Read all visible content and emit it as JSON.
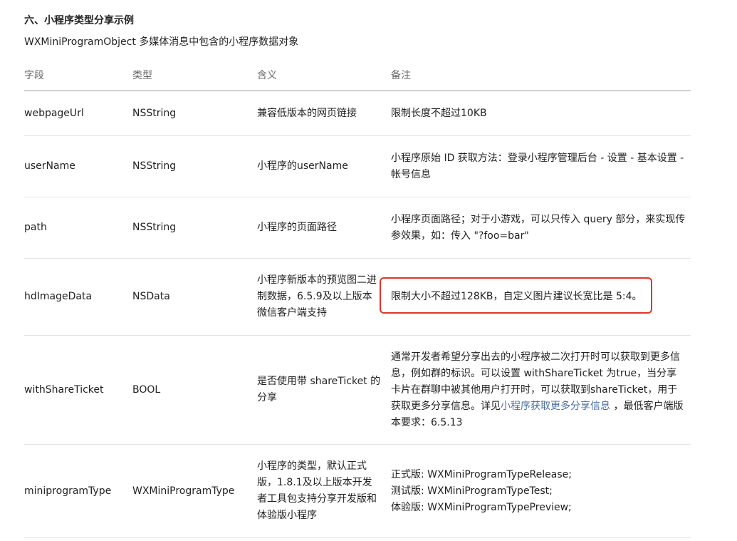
{
  "heading": {
    "title": "六、小程序类型分享示例",
    "description": "WXMiniProgramObject 多媒体消息中包含的小程序数据对象"
  },
  "table": {
    "headers": [
      "字段",
      "类型",
      "含义",
      "备注"
    ],
    "rows": [
      {
        "field": "webpageUrl",
        "type": "NSString",
        "meaning": "兼容低版本的网页链接",
        "note": "限制长度不超过10KB"
      },
      {
        "field": "userName",
        "type": "NSString",
        "meaning": "小程序的userName",
        "note": "小程序原始 ID 获取方法：登录小程序管理后台 - 设置 - 基本设置 - 帐号信息"
      },
      {
        "field": "path",
        "type": "NSString",
        "meaning": "小程序的页面路径",
        "note": "小程序页面路径；对于小游戏，可以只传入 query 部分，来实现传参效果，如：传入 \"?foo=bar\""
      },
      {
        "field": "hdImageData",
        "type": "NSData",
        "meaning": "小程序新版本的预览图二进制数据，6.5.9及以上版本微信客户端支持",
        "note": "限制大小不超过128KB，自定义图片建议长宽比是 5:4。"
      },
      {
        "field": "withShareTicket",
        "type": "BOOL",
        "meaning": "是否使用带 shareTicket 的分享",
        "note_before": "通常开发者希望分享出去的小程序被二次打开时可以获取到更多信息，例如群的标识。可以设置 withShareTicket 为true，当分享卡片在群聊中被其他用户打开时，可以获取到shareTicket，用于获取更多分享信息。详见",
        "note_link": "小程序获取更多分享信息",
        "note_after": " ，最低客户端版本要求：6.5.13"
      },
      {
        "field": "miniprogramType",
        "type": "WXMiniProgramType",
        "meaning": "小程序的类型，默认正式版，1.8.1及以上版本开发者工具包支持分享开发版和体验版小程序",
        "note_lines": [
          "正式版: WXMiniProgramTypeRelease;",
          "测试版: WXMiniProgramTypeTest;",
          "体验版: WXMiniProgramTypePreview;"
        ]
      }
    ]
  },
  "colors": {
    "highlight_border": "#e5332a",
    "link": "#4a6fa8"
  }
}
